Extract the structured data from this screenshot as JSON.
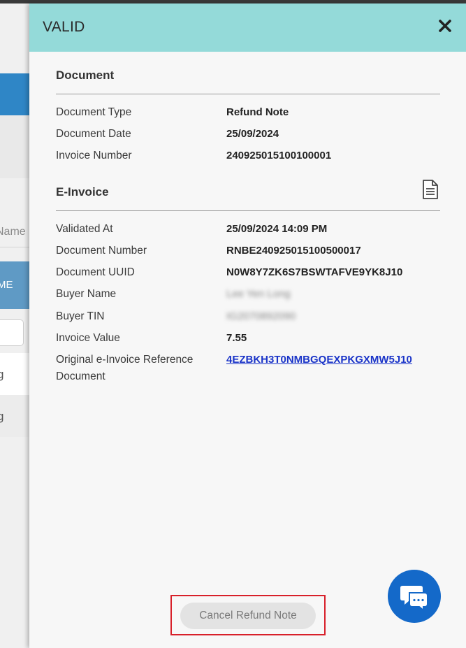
{
  "background": {
    "name_column_fragment": "Name",
    "header_fragment": "ME",
    "row_fragments": [
      "g",
      "g"
    ]
  },
  "panel": {
    "title": "VALID",
    "close_icon": "close-icon",
    "document_section": {
      "title": "Document",
      "rows": [
        {
          "label": "Document Type",
          "value": "Refund Note"
        },
        {
          "label": "Document Date",
          "value": "25/09/2024"
        },
        {
          "label": "Invoice Number",
          "value": "240925015100100001"
        }
      ]
    },
    "einvoice_section": {
      "title": "E-Invoice",
      "icon": "document-icon",
      "rows": [
        {
          "label": "Validated At",
          "value": "25/09/2024 14:09 PM"
        },
        {
          "label": "Document Number",
          "value": "RNBE240925015100500017"
        },
        {
          "label": "Document UUID",
          "value": "N0W8Y7ZK6S7BSWTAFVE9YK8J10"
        },
        {
          "label": "Buyer Name",
          "value": "Lee Yen Long"
        },
        {
          "label": "Buyer TIN",
          "value": "IG2070892090"
        },
        {
          "label": "Invoice Value",
          "value": "7.55"
        },
        {
          "label": "Original e-Invoice Reference Document",
          "value": "4EZBKH3T0NMBGQEXPKGXMW5J10"
        }
      ]
    },
    "cancel_button_label": "Cancel Refund Note",
    "chat_icon": "chat-icon"
  },
  "colors": {
    "header": "#94dad9",
    "link": "#1a34c8",
    "chat": "#1469c9",
    "highlight": "#d8202a"
  }
}
